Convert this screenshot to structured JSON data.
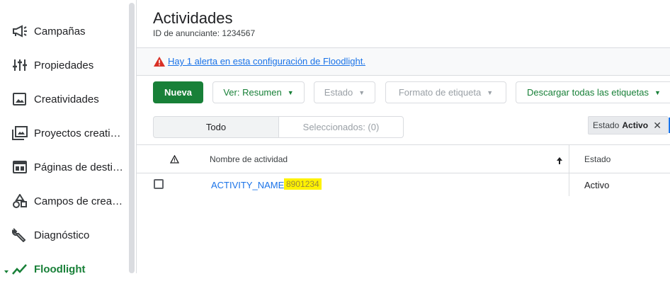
{
  "sidebar": {
    "items": [
      {
        "label": "Campañas",
        "icon": "megaphone-icon"
      },
      {
        "label": "Propiedades",
        "icon": "sliders-icon"
      },
      {
        "label": "Creatividades",
        "icon": "image-icon"
      },
      {
        "label": "Proyectos creativos",
        "icon": "photo-library-icon"
      },
      {
        "label": "Páginas de destino",
        "icon": "web-page-icon"
      },
      {
        "label": "Campos de creatividad",
        "icon": "shapes-icon"
      },
      {
        "label": "Diagnóstico",
        "icon": "wrench-icon"
      },
      {
        "label": "Floodlight",
        "icon": "trend-line-icon"
      }
    ]
  },
  "header": {
    "title": "Actividades",
    "advertiser_label": "ID de anunciante: 1234567"
  },
  "alert": {
    "text": "Hay 1 alerta en esta configuración de Floodlight."
  },
  "toolbar": {
    "new_label": "Nueva",
    "view_label": "Ver: Resumen",
    "state_label": "Estado",
    "format_label": "Formato de etiqueta",
    "download_label": "Descargar todas las etiquetas"
  },
  "segments": {
    "all_label": "Todo",
    "selected_label": "Seleccionados: (0)"
  },
  "filter_chip": {
    "key": "Estado",
    "value": "Activo"
  },
  "table": {
    "columns": {
      "name": "Nombre de actividad",
      "state": "Estado"
    },
    "rows": [
      {
        "name": "ACTIVITY_NAME",
        "id": "8901234",
        "state": "Activo"
      }
    ]
  },
  "colors": {
    "accent_green": "#188038",
    "link_blue": "#1a73e8",
    "alert_red": "#d93025",
    "highlight_yellow": "#fef200"
  }
}
